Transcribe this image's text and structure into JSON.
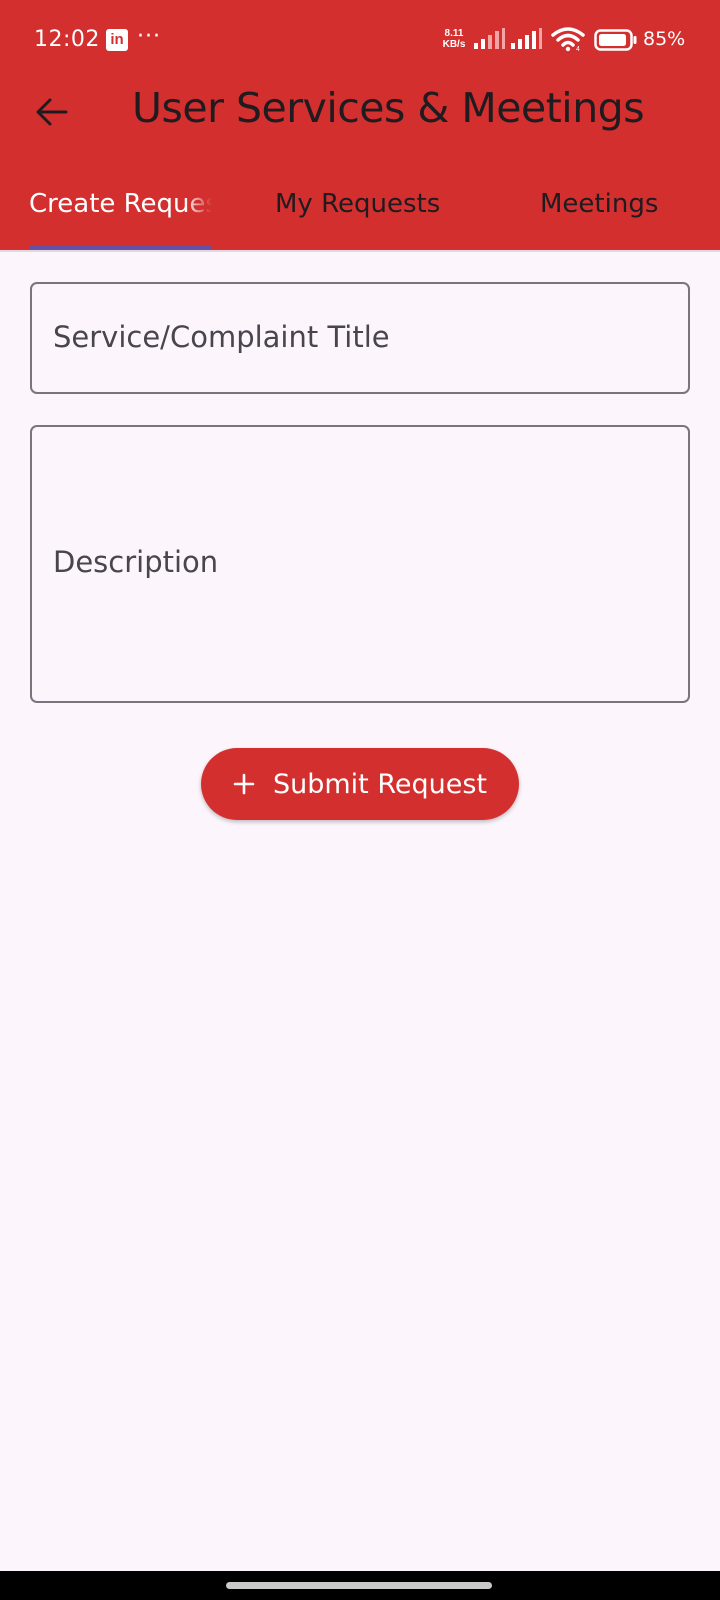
{
  "status_bar": {
    "time": "12:02",
    "notification_icon": "linkedin-icon",
    "linkedin_glyph": "in",
    "more": "···",
    "net_speed_value": "8.11",
    "net_speed_unit": "KB/s",
    "battery": "85%"
  },
  "app_bar": {
    "title": "User Services & Meetings",
    "back_icon": "arrow-back-icon"
  },
  "tabs": [
    {
      "label": "Create Request",
      "selected": true
    },
    {
      "label": "My Requests",
      "selected": false
    },
    {
      "label": "Meetings",
      "selected": false
    }
  ],
  "form": {
    "title_label": "Service/Complaint Title",
    "description_label": "Description",
    "submit_label": "Submit Request",
    "submit_icon": "plus-icon"
  },
  "colors": {
    "primary": "#d32f2f",
    "tab_indicator": "#6750a4",
    "background": "#fcf6fc",
    "outline": "#79747e"
  }
}
